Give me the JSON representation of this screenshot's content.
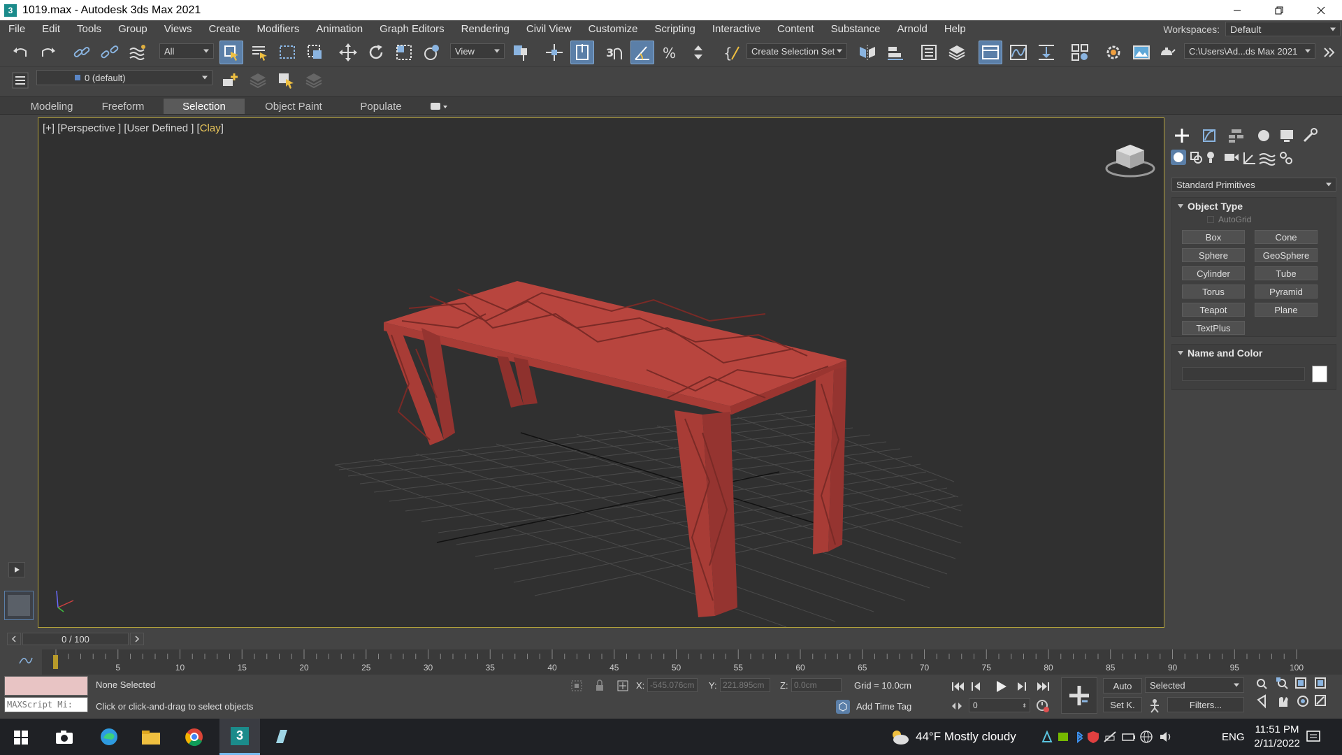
{
  "window": {
    "app_icon": "3",
    "title": "1019.max - Autodesk 3ds Max 2021"
  },
  "menu": {
    "items": [
      "File",
      "Edit",
      "Tools",
      "Group",
      "Views",
      "Create",
      "Modifiers",
      "Animation",
      "Graph Editors",
      "Rendering",
      "Civil View",
      "Customize",
      "Scripting",
      "Interactive",
      "Content",
      "Substance",
      "Arnold",
      "Help"
    ],
    "workspaces_label": "Workspaces:",
    "workspace_value": "Default"
  },
  "toolbar": {
    "selection_filter": "All",
    "ref_coord": "View",
    "selection_set": "Create Selection Set",
    "project_path": "C:\\Users\\Ad...ds Max 2021",
    "layer_value": "0 (default)"
  },
  "ribbon": {
    "tabs": [
      "Modeling",
      "Freeform",
      "Selection",
      "Object Paint",
      "Populate"
    ],
    "selected": "Selection"
  },
  "viewport": {
    "label_plus": "[+]",
    "label_view": "[Perspective ]",
    "label_user": "[User Defined ]",
    "label_clay_open": "[",
    "label_clay": "Clay",
    "label_clay_close": "]",
    "object_color": "#b8453e"
  },
  "command_panel": {
    "category": "Standard Primitives",
    "object_type_title": "Object Type",
    "autogrid": "AutoGrid",
    "buttons": [
      "Box",
      "Cone",
      "Sphere",
      "GeoSphere",
      "Cylinder",
      "Tube",
      "Torus",
      "Pyramid",
      "Teapot",
      "Plane",
      "TextPlus"
    ],
    "name_color_title": "Name and Color"
  },
  "timeline": {
    "frame_display": "0 / 100",
    "ticks": [
      "5",
      "10",
      "15",
      "20",
      "25",
      "30",
      "35",
      "40",
      "45",
      "50",
      "55",
      "60",
      "65",
      "70",
      "75",
      "80",
      "85",
      "90",
      "95",
      "100"
    ]
  },
  "status": {
    "maxscript": "MAXScript Mi:",
    "selection_state": "None Selected",
    "prompt": "Click or click-and-drag to select objects",
    "x_label": "X:",
    "x_value": "-545.076cm",
    "y_label": "Y:",
    "y_value": "221.895cm",
    "z_label": "Z:",
    "z_value": "0.0cm",
    "grid": "Grid = 10.0cm",
    "add_time_tag": "Add Time Tag",
    "auto": "Auto",
    "selected": "Selected",
    "set_key": "Set K.",
    "filters": "Filters...",
    "frame_value": "0"
  },
  "taskbar": {
    "weather": "44°F  Mostly cloudy",
    "language": "ENG",
    "time": "11:51 PM",
    "date": "2/11/2022"
  }
}
